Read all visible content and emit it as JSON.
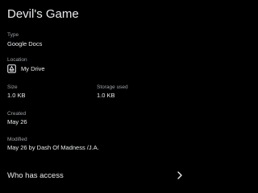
{
  "file": {
    "title": "Devil's Game"
  },
  "details": {
    "type_label": "Type",
    "type_value": "Google Docs",
    "location_label": "Location",
    "location_value": "My Drive",
    "location_icon": "drive-folder-icon",
    "size_label": "Size",
    "size_value": "1.0 KB",
    "storage_label": "Storage used",
    "storage_value": "1.0 KB",
    "created_label": "Created",
    "created_value": "May 26",
    "modified_label": "Modified",
    "modified_value": "May 26 by Dash Of Madness /J.A."
  },
  "access": {
    "label": "Who has access",
    "icon": "chevron-right-icon"
  },
  "colors": {
    "background": "#000000",
    "text_primary": "#e8eaed",
    "text_secondary": "#9aa0a6"
  }
}
